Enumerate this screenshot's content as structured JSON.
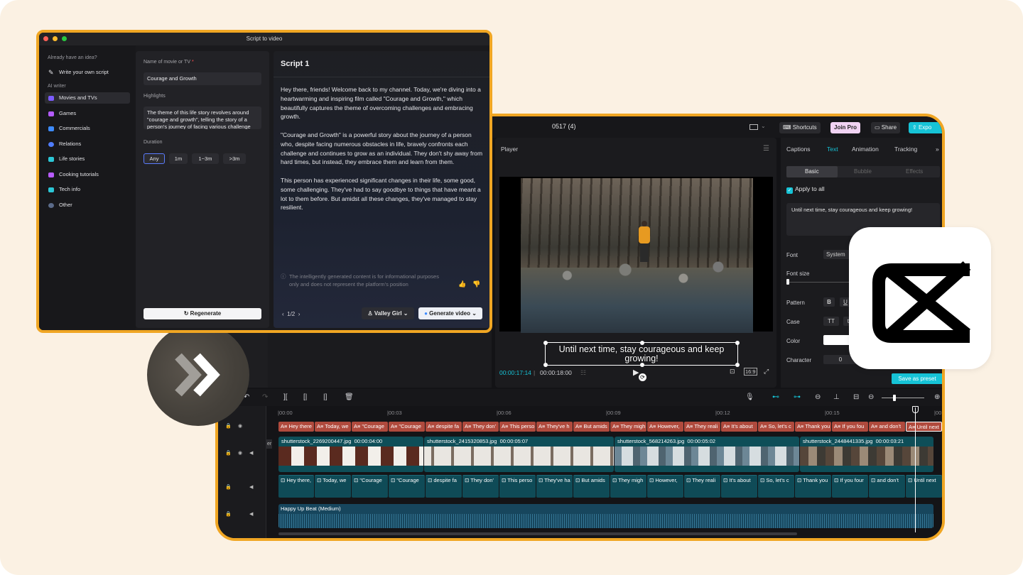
{
  "editor": {
    "project_title": "0517 (4)",
    "shortcuts": "Shortcuts",
    "join_pro": "Join Pro",
    "share": "Share",
    "export": "Expo",
    "player_label": "Player",
    "subtitle": "Until next time, stay courageous and keep growing!",
    "current_time": "00:00:17:14",
    "total_time": "00:00:18:00",
    "aspect_ratio": "16:9",
    "right_tabs": [
      "Captions",
      "Text",
      "Animation",
      "Tracking"
    ],
    "active_tab": "Text",
    "segments": [
      "Basic",
      "Bubble",
      "Effects"
    ],
    "apply_to_all": "Apply to all",
    "text_content": "Until next time, stay courageous and keep growing!",
    "font_label": "Font",
    "font_value": "System",
    "font_size_label": "Font size",
    "pattern_label": "Pattern",
    "bold_label": "B",
    "underline_label": "U",
    "case_label": "Case",
    "case_value": "TT",
    "case_value2": "tt",
    "color_label": "Color",
    "character_label": "Character",
    "character_value": "0",
    "save_preset": "Save as preset",
    "ruler": [
      "|00:00",
      "|00:03",
      "|00:06",
      "|00:09",
      "|00:12",
      "|00:15",
      "|00"
    ],
    "caption_clips": [
      "A≡ Hey there",
      "A≡ Today, we",
      "A≡ \"Courage",
      "A≡ \"Courage",
      "A≡ despite fa",
      "A≡ They don'",
      "A≡ This perso",
      "A≡ They've h",
      "A≡ But amids",
      "A≡ They migh",
      "A≡ However,",
      "A≡ They reali",
      "A≡ It's about",
      "A≡ So, let's c",
      "A≡ Thank you",
      "A≡ If you fou",
      "A≡ and don't",
      "A≡ Until next"
    ],
    "video_clips": [
      {
        "name": "shutterstock_2269200447.jpg",
        "duration": "00:00:04:00"
      },
      {
        "name": "shutterstock_2415320853.jpg",
        "duration": "00:00:05:07"
      },
      {
        "name": "shutterstock_568214263.jpg",
        "duration": "00:00:05:02"
      },
      {
        "name": "shutterstock_2448441335.jpg",
        "duration": "00:00:03:21"
      }
    ],
    "tts_clips": [
      "⊡ Hey there,",
      "⊡ Today, we",
      "⊡ \"Courage",
      "⊡ \"Courage",
      "⊡ despite fa",
      "⊡ They don'",
      "⊡ This perso",
      "⊡ They've ha",
      "⊡ But amids",
      "⊡ They migh",
      "⊡ However,",
      "⊡ They reali",
      "⊡ It's about",
      "⊡ So, let's c",
      "⊡ Thank you",
      "⊡ If you four",
      "⊡ and don't",
      "⊡ Until next"
    ],
    "audio_name": "Happy Up Beat (Medium)",
    "track_cover_label": "er"
  },
  "script_window": {
    "title": "Script to video",
    "nav_heading_1": "Already have an idea?",
    "write_own": "Write your own script",
    "nav_heading_2": "AI writer",
    "nav_items": [
      "Movies and TVs",
      "Games",
      "Commercials",
      "Relations",
      "Life stories",
      "Cooking tutorials",
      "Tech info",
      "Other"
    ],
    "name_label": "Name of movie or TV",
    "name_required": "*",
    "name_value": "Courage and Growth",
    "highlights_label": "Highlights",
    "highlights_value": "The theme of this life story revolves around \"courage and growth\", telling the story of a person's journey of facing various challenge",
    "duration_label": "Duration",
    "durations": [
      "Any",
      "1m",
      "1~3m",
      ">3m"
    ],
    "regenerate": "Regenerate",
    "script_title": "Script 1",
    "script_paragraphs": [
      "Hey there, friends! Welcome back to my channel. Today, we're diving into a heartwarming and inspiring film called \"Courage and Growth,\" which beautifully captures the theme of overcoming challenges and embracing growth.",
      "\"Courage and Growth\" is a powerful story about the journey of a person who, despite facing numerous obstacles in life, bravely confronts each challenge and continues to grow as an individual. They don't shy away from hard times, but instead, they embrace them and learn from them.",
      "This person has experienced significant changes in their life, some good, some challenging. They've had to say goodbye to things that have meant a lot to them before. But amidst all these changes, they've managed to stay resilient."
    ],
    "disclaimer": "The intelligently generated content is for informational purposes only and does not represent the platform's position",
    "page": "1/2",
    "voice": "Valley Girl",
    "generate": "Generate video"
  },
  "colors": {
    "accent": "#16c3d6",
    "frame_orange": "#f0a623",
    "caption_red": "#b04a3d",
    "background": "#fbf1e3"
  },
  "icons": [
    "pencil-icon",
    "gear-icon",
    "double-chevron-right-icon",
    "capcut-logo-icon",
    "play-icon",
    "thumbs-up-icon",
    "thumbs-down-icon",
    "lock-icon",
    "eye-icon",
    "speaker-icon",
    "trash-icon",
    "undo-icon",
    "redo-icon",
    "mic-icon"
  ]
}
